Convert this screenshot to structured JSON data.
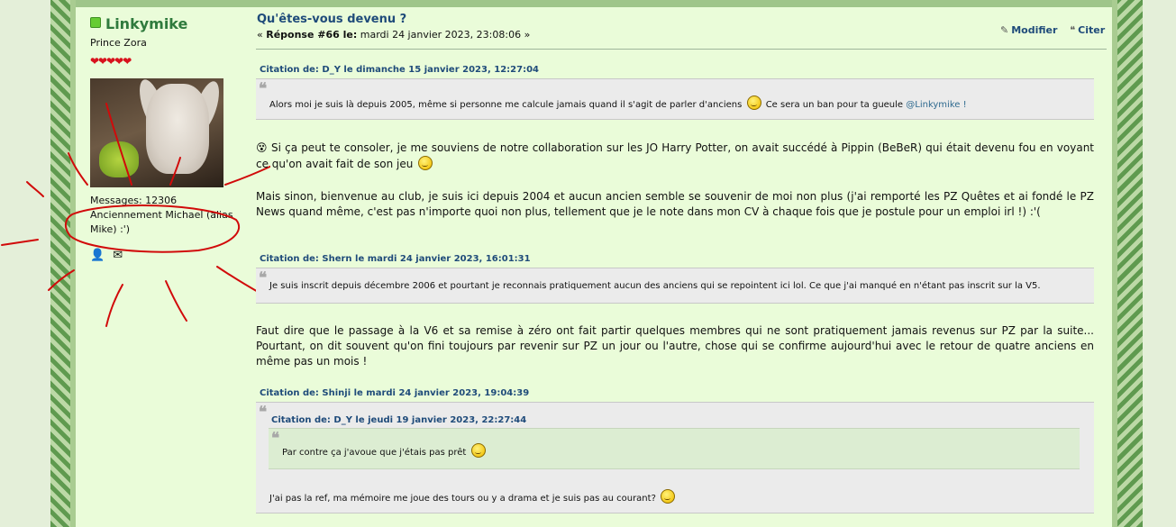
{
  "poster": {
    "name": "Linkymike",
    "rank": "Prince Zora",
    "hearts": "❤❤❤❤❤",
    "messages": "Messages: 12306",
    "former_name": "Anciennement Michael (alias Mike) :')",
    "icons": [
      "profile-icon",
      "message-icon"
    ]
  },
  "post": {
    "title": "Qu'êtes-vous devenu ?",
    "reply_prefix": "« ",
    "reply_label": "Réponse #66 le:",
    "reply_date": " mardi 24 janvier 2023, 23:08:06 »",
    "actions": {
      "edit": "Modifier",
      "quote": "Citer"
    }
  },
  "quotes": [
    {
      "header": "Citation de: D_Y le dimanche 15 janvier 2023, 12:27:04",
      "text_before": "Alors moi je suis là depuis 2005, même si personne me calcule jamais quand il s'agit de parler d'anciens",
      "text_after": "Ce sera un ban pour ta gueule",
      "mention": "@Linkymike !"
    },
    {
      "header": "Citation de: Shern le mardi 24 janvier 2023, 16:01:31",
      "text": "Je suis inscrit depuis décembre 2006 et pourtant je reconnais pratiquement aucun des anciens qui se repointent ici lol. Ce que j'ai manqué en n'étant pas inscrit sur la V5."
    },
    {
      "header": "Citation de: Shinji le mardi 24 janvier 2023, 19:04:39",
      "nested_header": "Citation de: D_Y le jeudi 19 janvier 2023, 22:27:44",
      "nested_text": "Par contre ça j'avoue que j'étais pas prêt",
      "text": "J'ai pas la ref, ma mémoire me joue des tours ou y a drama et je suis pas au courant?"
    }
  ],
  "paragraphs": {
    "p1": "Si ça peut te consoler, je me souviens de notre collaboration sur les JO Harry Potter, on avait succédé à Pippin (BeBeR) qui était devenu fou en voyant ce qu'on avait fait de son jeu",
    "p2_before": "Mais sinon, bienvenue au club, je suis ici depuis 2004 et aucun ancien semble se souvenir de moi non plus (j'ai remporté les PZ Quêtes et ai fondé le ",
    "p2_link": "PZ News",
    "p2_after": " quand même, c'est pas n'importe quoi non plus, tellement que je le note dans mon CV à chaque fois que je postule pour un emploi irl !) :'(",
    "p3": "Faut dire que le passage à la V6 et sa remise à zéro ont fait partir quelques membres qui ne sont pratiquement jamais revenus sur PZ par la suite... Pourtant, on dit souvent qu'on fini toujours par revenir sur PZ un jour ou l'autre, chose qui se confirme aujourd'hui avec le retour de quatre anciens en même pas un mois !"
  },
  "colors": {
    "title": "#1f4b7a",
    "username": "#2f7a3d",
    "scribble": "#d10a0a"
  }
}
